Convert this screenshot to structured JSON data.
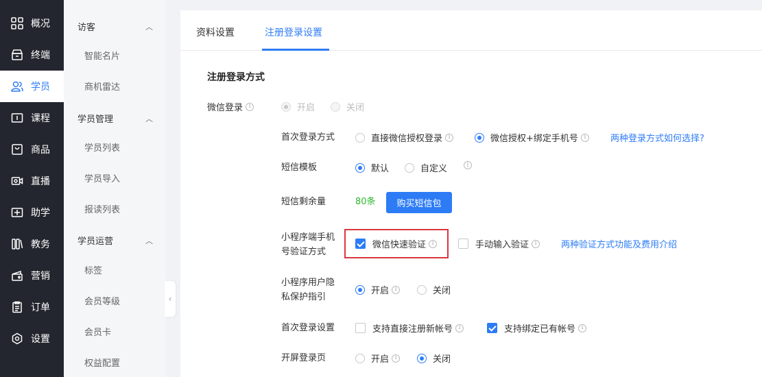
{
  "nav": {
    "items": [
      {
        "label": "概况",
        "icon": "overview-icon"
      },
      {
        "label": "终端",
        "icon": "terminal-icon"
      },
      {
        "label": "学员",
        "icon": "students-icon",
        "active": true
      },
      {
        "label": "课程",
        "icon": "course-icon"
      },
      {
        "label": "商品",
        "icon": "goods-icon"
      },
      {
        "label": "直播",
        "icon": "live-icon"
      },
      {
        "label": "助学",
        "icon": "assist-icon"
      },
      {
        "label": "教务",
        "icon": "academic-icon"
      },
      {
        "label": "营销",
        "icon": "marketing-icon"
      },
      {
        "label": "订单",
        "icon": "order-icon"
      },
      {
        "label": "设置",
        "icon": "settings-icon"
      }
    ]
  },
  "subnav": {
    "groups": [
      {
        "title": "访客",
        "items": [
          "智能名片",
          "商机雷达"
        ]
      },
      {
        "title": "学员管理",
        "items": [
          "学员列表",
          "学员导入",
          "报读列表"
        ]
      },
      {
        "title": "学员运营",
        "items": [
          "标签",
          "会员等级",
          "会员卡",
          "权益配置"
        ]
      }
    ],
    "collapse_glyph": "‹"
  },
  "tabs": {
    "profile": "资料设置",
    "register": "注册登录设置"
  },
  "section_title": "注册登录方式",
  "wechat_login": {
    "label": "微信登录",
    "on": "开启",
    "off": "关闭"
  },
  "first_login_method": {
    "label": "首次登录方式",
    "opt1": "直接微信授权登录",
    "opt2": "微信授权+绑定手机号",
    "help_link": "两种登录方式如何选择?"
  },
  "sms_template": {
    "label": "短信模板",
    "opt1": "默认",
    "opt2": "自定义"
  },
  "sms_balance": {
    "label": "短信剩余量",
    "value": "80条",
    "buy_button": "购买短信包"
  },
  "mini_phone_verify": {
    "label_line1": "小程序端手机",
    "label_line2": "号验证方式",
    "opt1": "微信快速验证",
    "opt2": "手动输入验证",
    "help_link": "两种验证方式功能及费用介绍"
  },
  "privacy_guide": {
    "label_line1": "小程序用户隐",
    "label_line2": "私保护指引",
    "on": "开启",
    "off": "关闭"
  },
  "first_login_settings": {
    "label": "首次登录设置",
    "opt1": "支持直接注册新帐号",
    "opt2": "支持绑定已有帐号"
  },
  "splash_login": {
    "label": "开屏登录页",
    "on": "开启",
    "off": "关闭"
  },
  "colors": {
    "accent": "#2d7cf6",
    "nav_bg": "#23262e",
    "highlight": "#d9363e",
    "green": "#2eb82e"
  }
}
